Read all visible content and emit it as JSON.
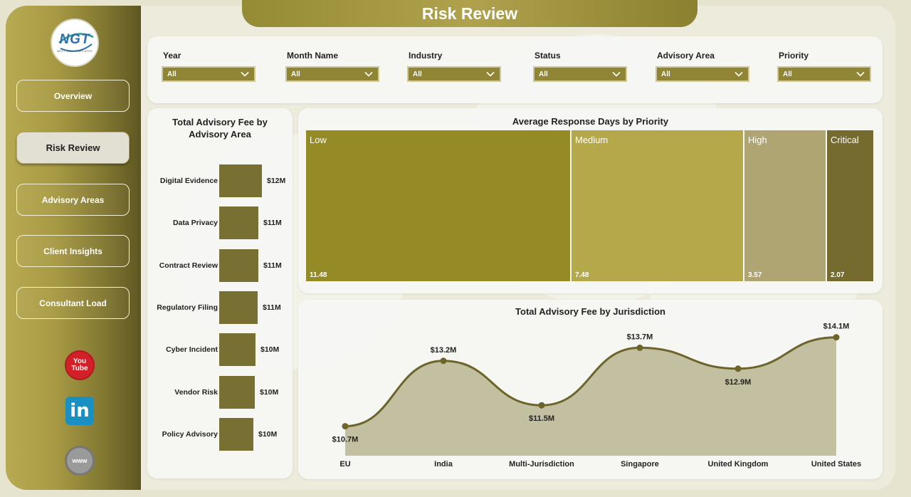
{
  "page": {
    "title": "Risk Review"
  },
  "logo": {
    "brand": "NGT",
    "subtitle": "NEXT GEN TEMPLATES"
  },
  "nav": {
    "items": [
      {
        "label": "Overview"
      },
      {
        "label": "Risk Review",
        "active": true
      },
      {
        "label": "Advisory Areas"
      },
      {
        "label": "Client Insights"
      },
      {
        "label": "Consultant Load"
      }
    ]
  },
  "social": {
    "youtube": "You Tube",
    "linkedin": "in",
    "web": "www"
  },
  "filters": [
    {
      "label": "Year",
      "value": "All"
    },
    {
      "label": "Month Name",
      "value": "All"
    },
    {
      "label": "Industry",
      "value": "All"
    },
    {
      "label": "Status",
      "value": "All"
    },
    {
      "label": "Advisory Area",
      "value": "All"
    },
    {
      "label": "Priority",
      "value": "All"
    }
  ],
  "colors": {
    "accent": "#8f8535",
    "bar": "#786f32",
    "area_fill": "#c3c0a1",
    "line": "#6c642a"
  },
  "chart_data": [
    {
      "type": "bar",
      "title": "Total Advisory Fee by Advisory Area",
      "orientation": "horizontal",
      "categories": [
        "Digital Evidence",
        "Data Privacy",
        "Contract Review",
        "Regulatory Filing",
        "Cyber Incident",
        "Vendor Risk",
        "Policy Advisory"
      ],
      "values": [
        12,
        11,
        11,
        11,
        10,
        10,
        10
      ],
      "value_labels": [
        "$12M",
        "$11M",
        "$11M",
        "$11M",
        "$10M",
        "$10M",
        "$10M"
      ],
      "bar_values": [
        11.8,
        10.9,
        10.8,
        10.6,
        10.0,
        9.8,
        9.4
      ]
    },
    {
      "type": "heatmap",
      "subtype": "treemap",
      "title": "Average Response Days by Priority",
      "categories": [
        "Low",
        "Medium",
        "High",
        "Critical"
      ],
      "values": [
        11.48,
        7.48,
        3.57,
        2.07
      ],
      "value_labels": [
        "11.48",
        "7.48",
        "3.57",
        "2.07"
      ],
      "colors": [
        "#948b26",
        "#b4a84a",
        "#aea572",
        "#756b2f"
      ]
    },
    {
      "type": "area",
      "title": "Total Advisory Fee by Jurisdiction",
      "categories": [
        "EU",
        "India",
        "Multi-Jurisdiction",
        "Singapore",
        "United Kingdom",
        "United States"
      ],
      "values": [
        10.7,
        13.2,
        11.5,
        13.7,
        12.9,
        14.1
      ],
      "value_labels": [
        "$10.7M",
        "$13.2M",
        "$11.5M",
        "$13.7M",
        "$12.9M",
        "$14.1M"
      ],
      "ylim": [
        9.6,
        14.5
      ]
    }
  ]
}
